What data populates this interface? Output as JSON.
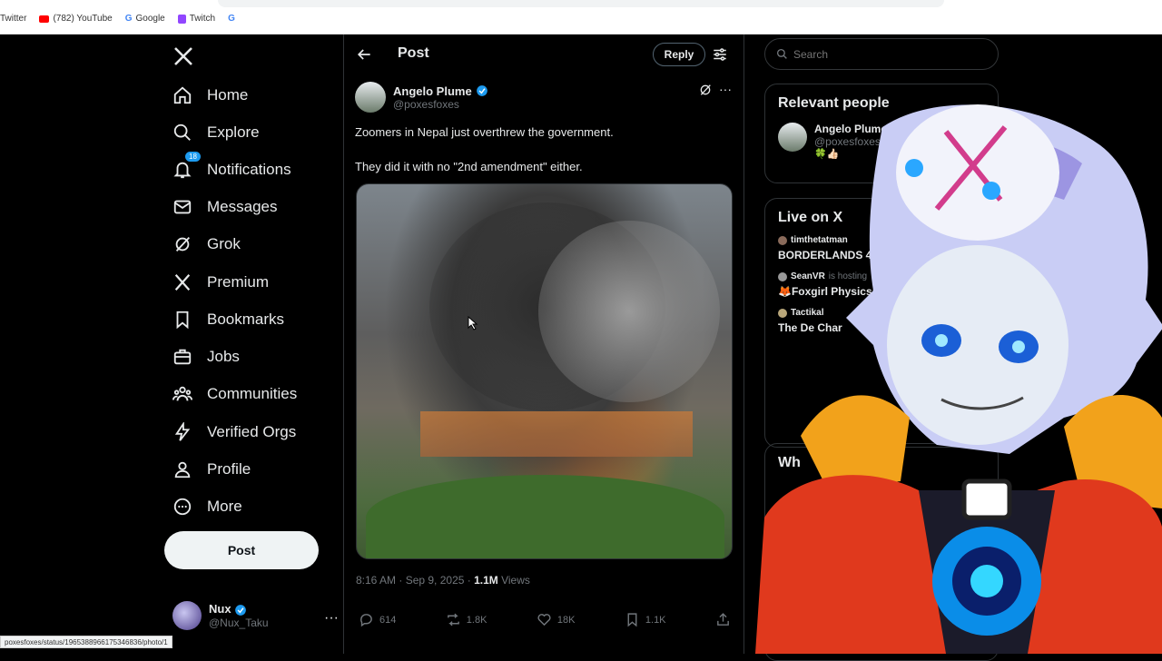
{
  "browser": {
    "bookmarks": [
      {
        "label": "Twitter"
      },
      {
        "label": "(782) YouTube"
      },
      {
        "label": "Google"
      },
      {
        "label": "Twitch"
      }
    ],
    "status_url": "poxesfoxes/status/1965388966175346836/photo/1"
  },
  "nav": {
    "items": [
      {
        "label": "Home"
      },
      {
        "label": "Explore"
      },
      {
        "label": "Notifications",
        "badge": "18"
      },
      {
        "label": "Messages"
      },
      {
        "label": "Grok"
      },
      {
        "label": "Premium"
      },
      {
        "label": "Bookmarks"
      },
      {
        "label": "Jobs"
      },
      {
        "label": "Communities"
      },
      {
        "label": "Verified Orgs"
      },
      {
        "label": "Profile"
      },
      {
        "label": "More"
      }
    ],
    "post_button": "Post",
    "account": {
      "name": "Nux",
      "handle": "@Nux_Taku"
    }
  },
  "main": {
    "title": "Post",
    "reply_button": "Reply",
    "author": {
      "name": "Angelo Plume",
      "handle": "@poxesfoxes"
    },
    "text_line1": "Zoomers in Nepal just overthrew the government.",
    "text_line2": "They did it with no \"2nd amendment\" either.",
    "timestamp": "8:16 AM · Sep 9, 2025 · ",
    "views_count": "1.1M",
    "views_label": " Views",
    "stats": {
      "replies": "614",
      "reposts": "1.8K",
      "likes": "18K",
      "bookmarks": "1.1K"
    }
  },
  "sidebar": {
    "search_placeholder": "Search",
    "relevant_title": "Relevant people",
    "person": {
      "name": "Angelo Plume",
      "handle": "@poxesfoxes",
      "bio": "🍀👍🏻"
    },
    "live_title": "Live on X",
    "live": [
      {
        "host": "timthetatman",
        "title": "BORDERLANDS 4 EA ACCESS"
      },
      {
        "host": "SeanVR",
        "hosting": "is hosting",
        "title": "🦊Foxgirl Physics: 50 Wiggle, 50% Ya"
      },
      {
        "host": "Tactikal",
        "title": "The De Char"
      }
    ],
    "next_title": "Wh"
  },
  "colors": {
    "accent": "#1d9bf0",
    "background": "#000000",
    "border": "#2f3336"
  }
}
